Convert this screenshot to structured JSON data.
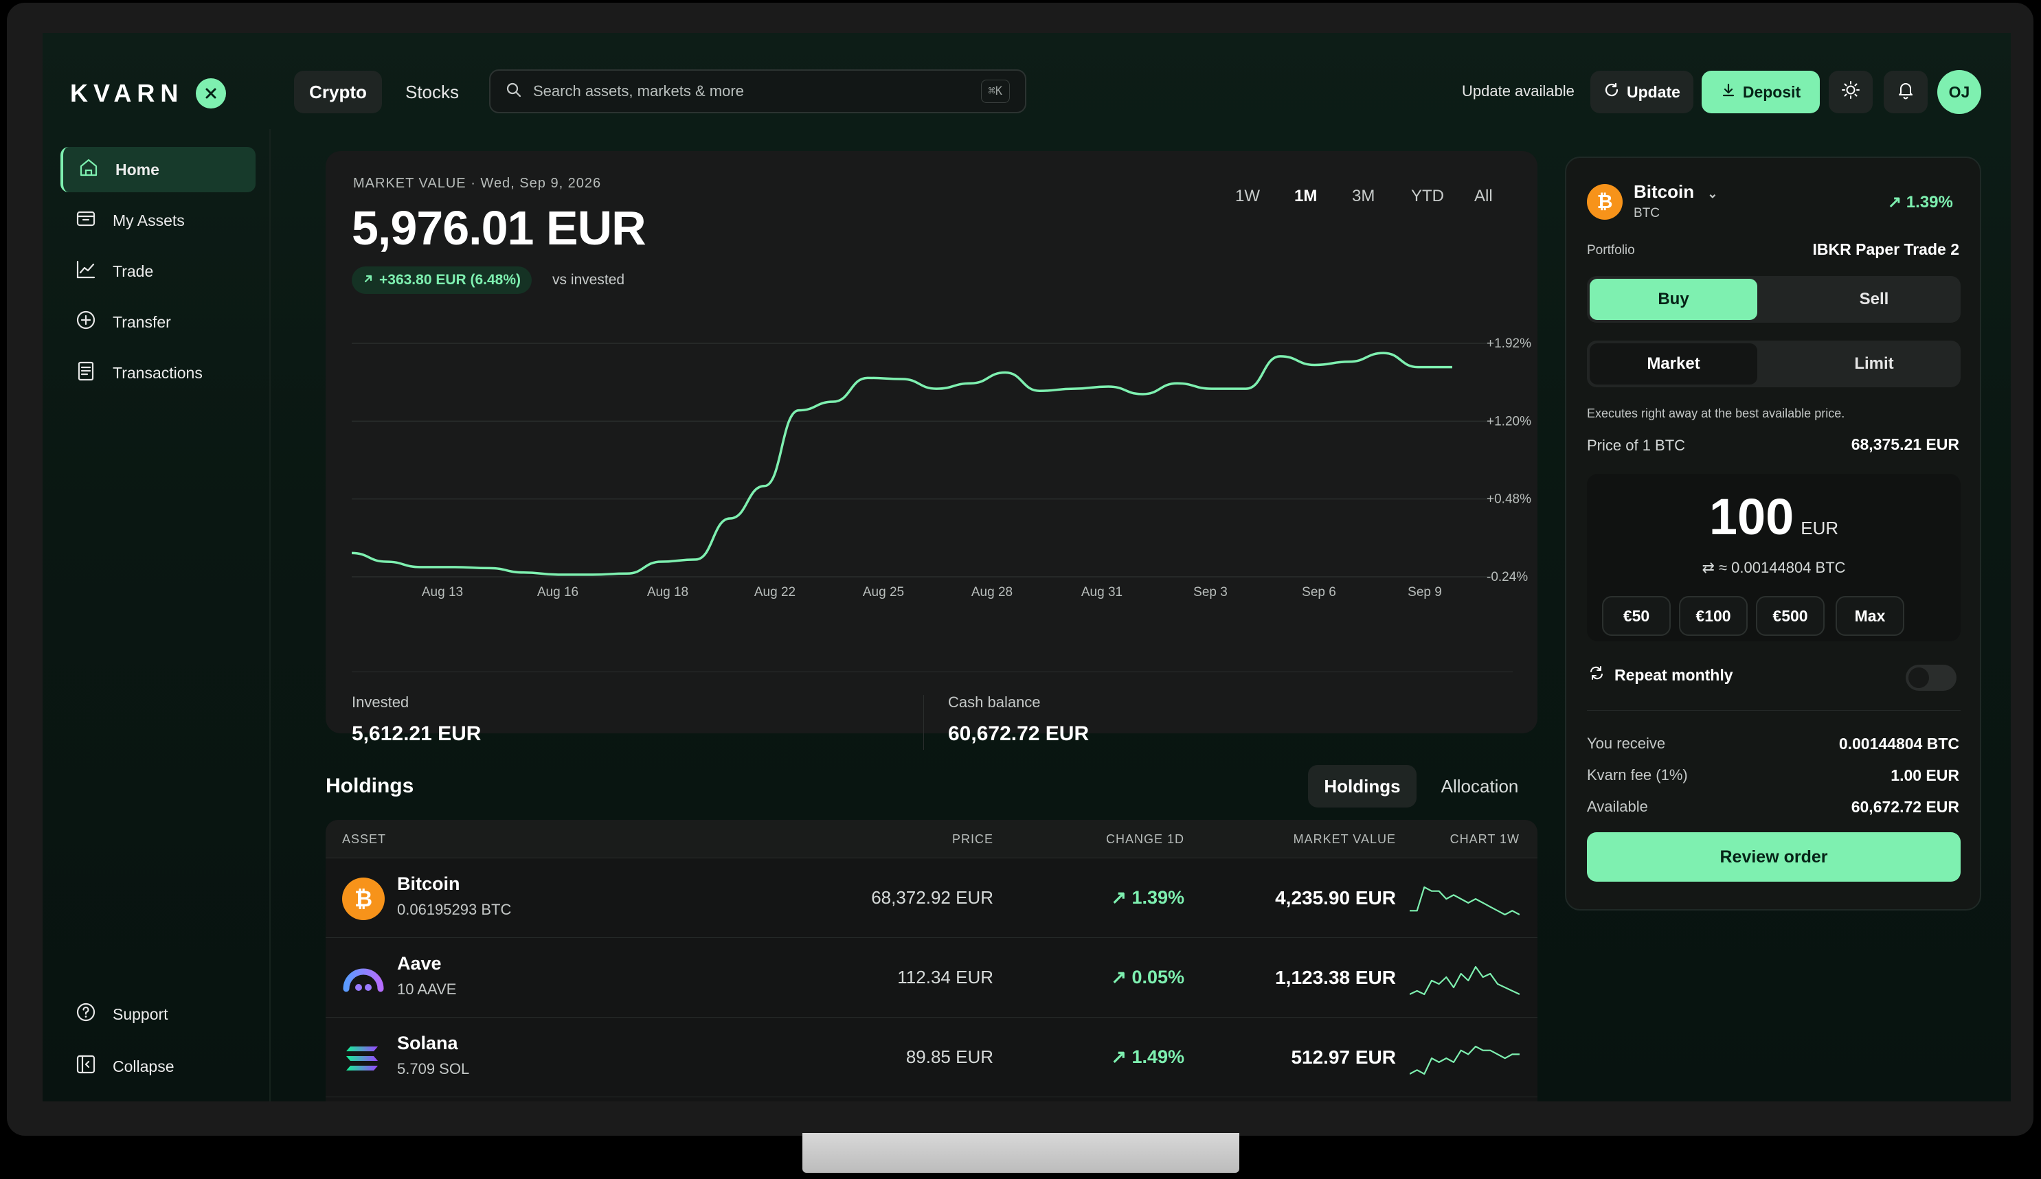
{
  "app": {
    "logo": "KVARN"
  },
  "topbar": {
    "tabs": [
      {
        "label": "Crypto",
        "active": true
      },
      {
        "label": "Stocks",
        "active": false
      }
    ],
    "search_placeholder": "Search assets, markets & more",
    "search_shortcut": "⌘K",
    "update_available": "Update available",
    "update_label": "Update",
    "deposit_label": "Deposit",
    "avatar_initials": "OJ"
  },
  "sidebar": {
    "items": [
      {
        "label": "Home",
        "icon": "home-icon",
        "active": true
      },
      {
        "label": "My Assets",
        "icon": "wallet-icon"
      },
      {
        "label": "Trade",
        "icon": "trend-icon"
      },
      {
        "label": "Transfer",
        "icon": "plus-circle-icon"
      },
      {
        "label": "Transactions",
        "icon": "receipt-icon"
      }
    ],
    "bottom": [
      {
        "label": "Support",
        "icon": "help-icon"
      },
      {
        "label": "Collapse",
        "icon": "collapse-icon"
      }
    ]
  },
  "market": {
    "label": "MARKET VALUE",
    "date": "Wed, Sep 9, 2026",
    "value": "5,976.01 EUR",
    "gain": "+363.80 EUR (6.48%)",
    "vs_label": "vs invested",
    "ranges": [
      "1W",
      "1M",
      "3M",
      "YTD",
      "All"
    ],
    "active_range": "1M",
    "invested_label": "Invested",
    "invested_value": "5,612.21 EUR",
    "cash_label": "Cash balance",
    "cash_value": "60,672.72 EUR"
  },
  "chart_data": {
    "type": "line",
    "x_ticks": [
      "Aug 13",
      "Aug 16",
      "Aug 18",
      "Aug 22",
      "Aug 25",
      "Aug 28",
      "Aug 31",
      "Sep 3",
      "Sep 6",
      "Sep 9"
    ],
    "y_ticks": [
      "+1.92%",
      "+1.20%",
      "+0.48%",
      "-0.24%"
    ],
    "ylim": [
      -0.24,
      1.92
    ],
    "series": [
      {
        "values": [
          -0.02,
          -0.1,
          -0.15,
          -0.15,
          -0.16,
          -0.2,
          -0.22,
          -0.22,
          -0.21,
          -0.1,
          -0.08,
          0.3,
          0.6,
          1.3,
          1.38,
          1.6,
          1.59,
          1.5,
          1.55,
          1.65,
          1.48,
          1.5,
          1.52,
          1.45,
          1.55,
          1.5,
          1.5,
          1.8,
          1.72,
          1.75,
          1.83,
          1.7,
          1.7
        ]
      }
    ],
    "color": "#7ef0b0",
    "grid": true
  },
  "holdings": {
    "title": "Holdings",
    "tabs": [
      {
        "label": "Holdings",
        "active": true
      },
      {
        "label": "Allocation",
        "active": false
      }
    ],
    "columns": [
      "ASSET",
      "PRICE",
      "CHANGE 1D",
      "MARKET VALUE",
      "CHART 1W"
    ],
    "rows": [
      {
        "name": "Bitcoin",
        "amount": "0.06195293 BTC",
        "price": "68,372.92 EUR",
        "change": "1.39%",
        "market_value": "4,235.90 EUR",
        "icon": "bitcoin-icon",
        "color": "#f7931a",
        "spark": [
          3,
          3,
          9,
          8,
          8,
          6,
          7,
          6,
          5,
          6,
          5,
          4,
          3,
          2,
          3,
          2
        ]
      },
      {
        "name": "Aave",
        "amount": "10 AAVE",
        "price": "112.34 EUR",
        "change": "0.05%",
        "market_value": "1,123.38 EUR",
        "icon": "aave-icon",
        "color": "#9a7bff",
        "spark": [
          2,
          3,
          2,
          6,
          5,
          7,
          4,
          8,
          6,
          10,
          7,
          8,
          5,
          4,
          3,
          2
        ]
      },
      {
        "name": "Solana",
        "amount": "5.709 SOL",
        "price": "89.85 EUR",
        "change": "1.49%",
        "market_value": "512.97 EUR",
        "icon": "solana-icon",
        "color": "#14f195",
        "spark": [
          2,
          3,
          2,
          6,
          5,
          6,
          5,
          8,
          7,
          9,
          8,
          8,
          7,
          6,
          7,
          7
        ]
      }
    ]
  },
  "trade": {
    "asset_name": "Bitcoin",
    "asset_ticker": "BTC",
    "asset_change": "1.39%",
    "portfolio_label": "Portfolio",
    "portfolio_value": "IBKR Paper Trade 2",
    "side_tabs": [
      {
        "label": "Buy",
        "active": true
      },
      {
        "label": "Sell",
        "active": false
      }
    ],
    "order_tabs": [
      {
        "label": "Market",
        "active": true
      },
      {
        "label": "Limit",
        "active": false
      }
    ],
    "exec_note": "Executes right away at the best available price.",
    "price_label": "Price of 1 BTC",
    "price_value": "68,375.21 EUR",
    "amount": "100",
    "amount_currency": "EUR",
    "amount_converted": "≈ 0.00144804 BTC",
    "presets": [
      "€50",
      "€100",
      "€500",
      "Max"
    ],
    "repeat_label": "Repeat monthly",
    "repeat_on": false,
    "summary": [
      {
        "label": "You receive",
        "value": "0.00144804 BTC"
      },
      {
        "label": "Kvarn fee (1%)",
        "value": "1.00 EUR"
      },
      {
        "label": "Available",
        "value": "60,672.72 EUR"
      }
    ],
    "review_label": "Review order"
  }
}
